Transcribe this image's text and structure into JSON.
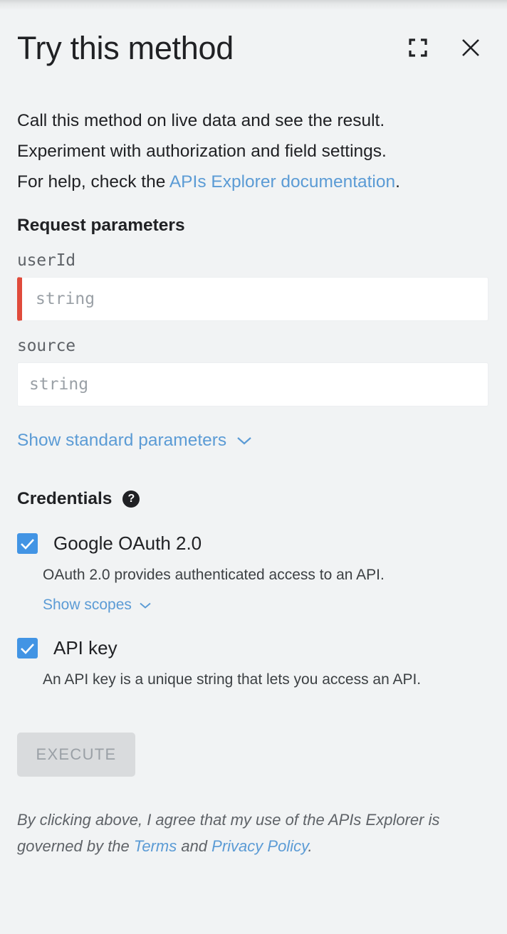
{
  "header": {
    "title": "Try this method",
    "fullscreen_icon": "fullscreen-icon",
    "close_icon": "close-icon"
  },
  "description": {
    "line1": "Call this method on live data and see the result.",
    "line2": "Experiment with authorization and field settings.",
    "line3_prefix": "For help, check the ",
    "link_text": "APIs Explorer documentation",
    "line3_suffix": "."
  },
  "request_parameters": {
    "section_title": "Request parameters",
    "fields": [
      {
        "name": "userId",
        "placeholder": "string",
        "value": "",
        "required": true
      },
      {
        "name": "source",
        "placeholder": "string",
        "value": "",
        "required": false
      }
    ],
    "show_standard_label": "Show standard parameters",
    "chevron_icon": "chevron-down-icon"
  },
  "credentials": {
    "section_title": "Credentials",
    "help_icon": "help-icon",
    "help_glyph": "?",
    "items": [
      {
        "label": "Google OAuth 2.0",
        "checked": true,
        "description": "OAuth 2.0 provides authenticated access to an API.",
        "sublink": "Show scopes",
        "sublink_icon": "chevron-down-icon"
      },
      {
        "label": "API key",
        "checked": true,
        "description": "An API key is a unique string that lets you access an API.",
        "sublink": null,
        "sublink_icon": null
      }
    ]
  },
  "execute": {
    "label": "EXECUTE",
    "disabled": true
  },
  "footer": {
    "part1": "By clicking above, I agree that my use of the APIs Explorer is governed by the ",
    "terms_link": "Terms",
    "part2": " and ",
    "privacy_link": "Privacy Policy",
    "part3": "."
  },
  "colors": {
    "background": "#f1f3f4",
    "link_blue": "#5b9bd5",
    "checkbox_blue": "#4294e4",
    "required_red": "#e04b3b",
    "text_primary": "#202124",
    "text_secondary": "#5f6368",
    "button_disabled_bg": "#d9dbdd",
    "button_disabled_text": "#9aa0a6"
  }
}
